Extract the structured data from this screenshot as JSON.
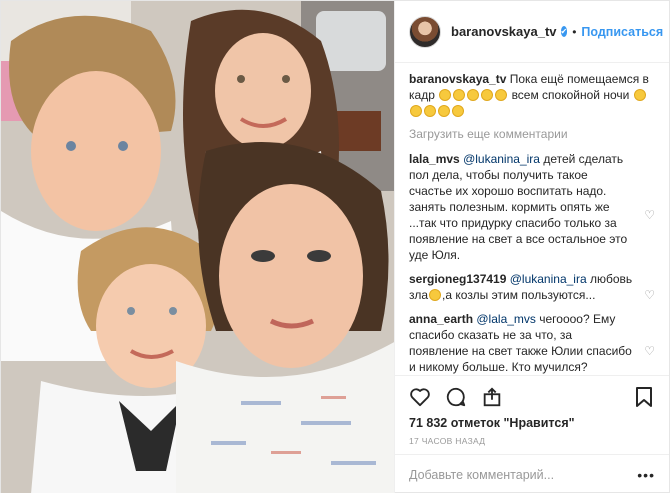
{
  "post": {
    "username": "baranovskaya_tv",
    "verified_mark": "✔",
    "separator": "•",
    "follow_label": "Подписаться"
  },
  "caption": {
    "username": "baranovskaya_tv",
    "text_part1": "Пока ещё помещаемся в кадр",
    "text_part2": "всем спокойной ночи"
  },
  "load_more": "Загрузить еще комментарии",
  "comments": [
    {
      "username": "lala_mvs",
      "mention": "@lukanina_ira",
      "text": "детей сделать пол дела, чтобы получить такое счастье их хорошо воспитать надо. занять полезным. кормить опять же ...так что придурку спасибо только за появление на свет а все остальное это уде Юля."
    },
    {
      "username": "sergioneg137419",
      "mention": "@lukanina_ira",
      "text_part1": "любовь зла",
      "text_part2": ",а козлы этим пользуются..."
    },
    {
      "username": "anna_earth",
      "mention": "@lala_mvs",
      "text": "чегоооо? Ему спасибо сказать не за что, за появление на свет также Юлии спасибо и никому больше. Кто мучился?"
    }
  ],
  "actions": {
    "likes": "71 832 отметок \"Нравится\"",
    "timestamp": "17 часов назад"
  },
  "add_comment": {
    "placeholder": "Добавьте комментарий...",
    "more": "•••"
  },
  "icons": [
    "heart-icon",
    "comment-icon",
    "share-icon",
    "bookmark-icon",
    "verified-icon"
  ],
  "colors": {
    "link": "#3897f0",
    "mention": "#003569",
    "muted": "#999999",
    "border": "#efefef"
  }
}
